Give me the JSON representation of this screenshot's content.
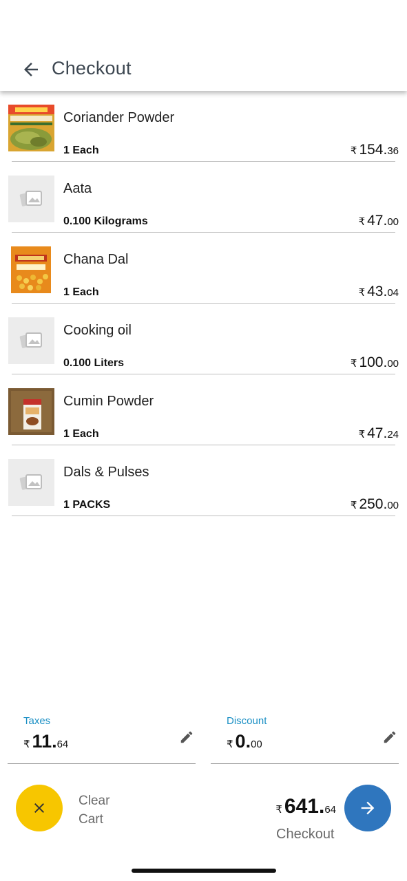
{
  "header": {
    "title": "Checkout",
    "back_icon": "arrow-left-icon"
  },
  "items": [
    {
      "name": "Coriander Powder",
      "qty": "1 Each",
      "currency": "₹",
      "price_int": "154.",
      "price_dec": "36",
      "image": "coriander-product"
    },
    {
      "name": "Aata",
      "qty": "0.100 Kilograms",
      "currency": "₹",
      "price_int": "47.",
      "price_dec": "00",
      "image": "placeholder"
    },
    {
      "name": "Chana Dal",
      "qty": "1 Each",
      "currency": "₹",
      "price_int": "43.",
      "price_dec": "04",
      "image": "chana-dal-product"
    },
    {
      "name": "Cooking oil",
      "qty": "0.100 Liters",
      "currency": "₹",
      "price_int": "100.",
      "price_dec": "00",
      "image": "placeholder"
    },
    {
      "name": "Cumin Powder",
      "qty": "1 Each",
      "currency": "₹",
      "price_int": "47.",
      "price_dec": "24",
      "image": "cumin-product"
    },
    {
      "name": "Dals & Pulses",
      "qty": "1 PACKS",
      "currency": "₹",
      "price_int": "250.",
      "price_dec": "00",
      "image": "placeholder"
    }
  ],
  "summary": {
    "taxes": {
      "label": "Taxes",
      "currency": "₹",
      "int": "11.",
      "dec": "64"
    },
    "discount": {
      "label": "Discount",
      "currency": "₹",
      "int": "0.",
      "dec": "00"
    }
  },
  "footer": {
    "clear_label_1": "Clear",
    "clear_label_2": "Cart",
    "total_currency": "₹",
    "total_int": "641.",
    "total_dec": "64",
    "checkout_label": "Checkout"
  },
  "colors": {
    "accent_yellow": "#f7c600",
    "accent_blue": "#2f76be",
    "label_blue": "#1a8fc4"
  }
}
